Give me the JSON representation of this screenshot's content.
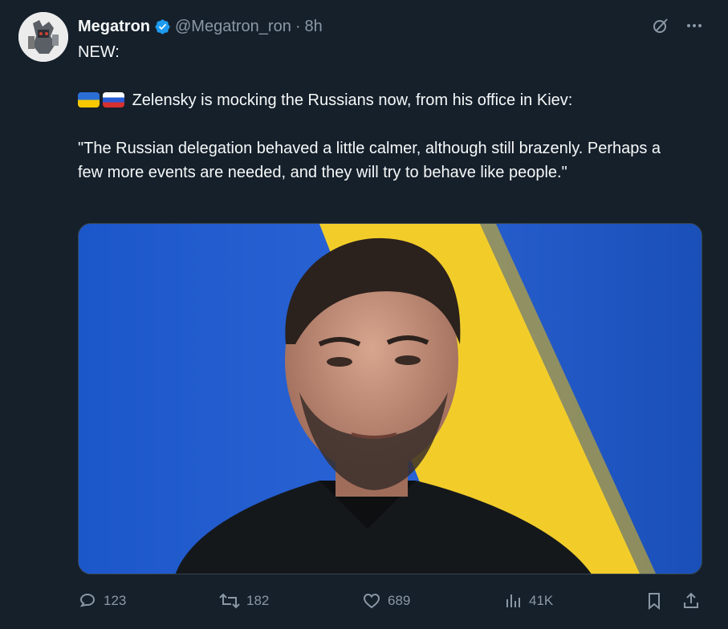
{
  "author": {
    "name": "Megatron",
    "handle": "@Megatron_ron",
    "separator": "·",
    "time": "8h"
  },
  "post": {
    "line1": "NEW:",
    "line2_flags": [
      "ukraine-flag",
      "russia-flag"
    ],
    "line2": "Zelensky is mocking the Russians now, from his office in Kiev:",
    "quote": "\"The Russian delegation behaved a little calmer, although still brazenly. Perhaps a few more events are needed, and they will try to behave like people.\""
  },
  "stats": {
    "replies": "123",
    "reposts": "182",
    "likes": "689",
    "views": "41K"
  },
  "colors": {
    "background": "#15202b",
    "text": "#f7f9f9",
    "muted": "#8b98a5",
    "verified": "#1d9bf0"
  },
  "icons": [
    "grok-icon",
    "more-icon",
    "reply-icon",
    "repost-icon",
    "like-icon",
    "views-icon",
    "bookmark-icon",
    "share-icon"
  ]
}
